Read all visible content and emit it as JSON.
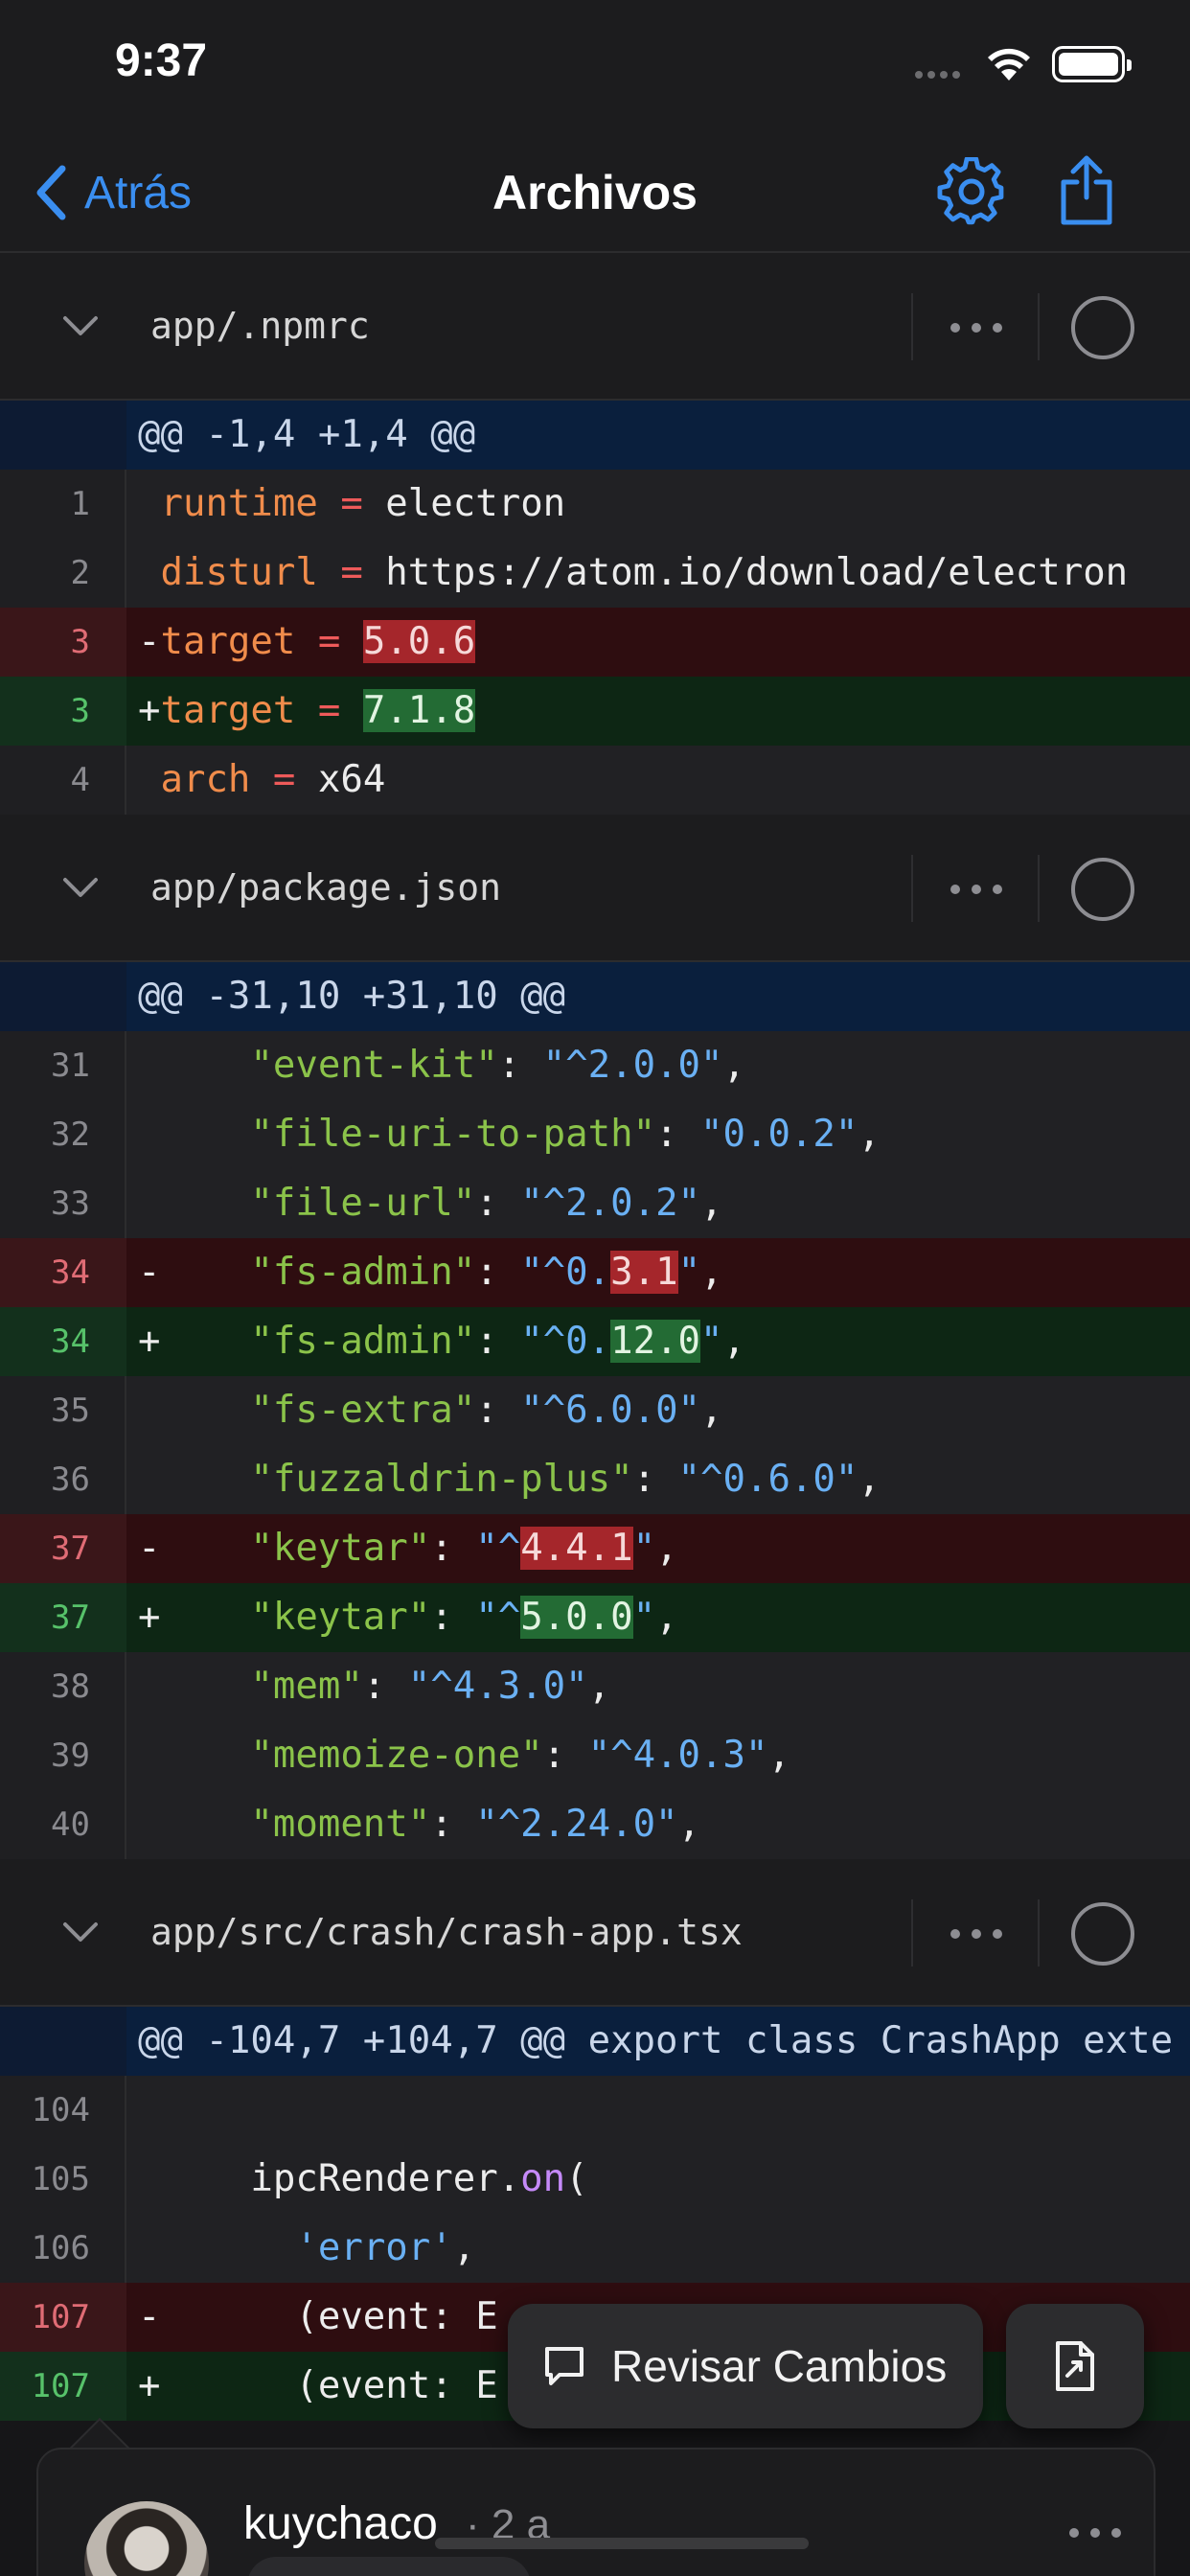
{
  "status_bar": {
    "time": "9:37"
  },
  "nav": {
    "back_label": "Atrás",
    "title": "Archivos"
  },
  "files": [
    {
      "path": "app/.npmrc",
      "lines": [
        {
          "type": "hunk",
          "num": "",
          "code": [
            {
              "t": "@@ -1,4 +1,4 @@"
            }
          ]
        },
        {
          "type": "ctx",
          "num": "1",
          "code": [
            {
              "t": " "
            },
            {
              "t": "runtime",
              "c": "k"
            },
            {
              "t": " "
            },
            {
              "t": "=",
              "c": "op"
            },
            {
              "t": " electron"
            }
          ]
        },
        {
          "type": "ctx",
          "num": "2",
          "code": [
            {
              "t": " "
            },
            {
              "t": "disturl",
              "c": "k"
            },
            {
              "t": " "
            },
            {
              "t": "=",
              "c": "op"
            },
            {
              "t": " https://atom.io/download/electron"
            }
          ]
        },
        {
          "type": "del",
          "num": "3",
          "code": [
            {
              "t": "-"
            },
            {
              "t": "target",
              "c": "k"
            },
            {
              "t": " "
            },
            {
              "t": "=",
              "c": "op"
            },
            {
              "t": " "
            },
            {
              "t": "5.0.6",
              "c": "hl-del"
            }
          ]
        },
        {
          "type": "add",
          "num": "3",
          "code": [
            {
              "t": "+"
            },
            {
              "t": "target",
              "c": "k"
            },
            {
              "t": " "
            },
            {
              "t": "=",
              "c": "op"
            },
            {
              "t": " "
            },
            {
              "t": "7.1.8",
              "c": "hl-add"
            }
          ]
        },
        {
          "type": "ctx",
          "num": "4",
          "code": [
            {
              "t": " "
            },
            {
              "t": "arch",
              "c": "k"
            },
            {
              "t": " "
            },
            {
              "t": "=",
              "c": "op"
            },
            {
              "t": " x64"
            }
          ]
        }
      ]
    },
    {
      "path": "app/package.json",
      "lines": [
        {
          "type": "hunk",
          "num": "",
          "code": [
            {
              "t": "@@ -31,10 +31,10 @@"
            }
          ]
        },
        {
          "type": "ctx",
          "num": "31",
          "code": [
            {
              "t": "     "
            },
            {
              "t": "\"event-kit\"",
              "c": "s"
            },
            {
              "t": ": "
            },
            {
              "t": "\"^2.0.0\"",
              "c": "n"
            },
            {
              "t": ","
            }
          ]
        },
        {
          "type": "ctx",
          "num": "32",
          "code": [
            {
              "t": "     "
            },
            {
              "t": "\"file-uri-to-path\"",
              "c": "s"
            },
            {
              "t": ": "
            },
            {
              "t": "\"0.0.2\"",
              "c": "n"
            },
            {
              "t": ","
            }
          ]
        },
        {
          "type": "ctx",
          "num": "33",
          "code": [
            {
              "t": "     "
            },
            {
              "t": "\"file-url\"",
              "c": "s"
            },
            {
              "t": ": "
            },
            {
              "t": "\"^2.0.2\"",
              "c": "n"
            },
            {
              "t": ","
            }
          ]
        },
        {
          "type": "del",
          "num": "34",
          "code": [
            {
              "t": "-    "
            },
            {
              "t": "\"fs-admin\"",
              "c": "s"
            },
            {
              "t": ": "
            },
            {
              "t": "\"^0.",
              "c": "n"
            },
            {
              "t": "3.1",
              "c": "hl-del"
            },
            {
              "t": "\"",
              "c": "n"
            },
            {
              "t": ","
            }
          ]
        },
        {
          "type": "add",
          "num": "34",
          "code": [
            {
              "t": "+    "
            },
            {
              "t": "\"fs-admin\"",
              "c": "s"
            },
            {
              "t": ": "
            },
            {
              "t": "\"^0.",
              "c": "n"
            },
            {
              "t": "12.0",
              "c": "hl-add"
            },
            {
              "t": "\"",
              "c": "n"
            },
            {
              "t": ","
            }
          ]
        },
        {
          "type": "ctx",
          "num": "35",
          "code": [
            {
              "t": "     "
            },
            {
              "t": "\"fs-extra\"",
              "c": "s"
            },
            {
              "t": ": "
            },
            {
              "t": "\"^6.0.0\"",
              "c": "n"
            },
            {
              "t": ","
            }
          ]
        },
        {
          "type": "ctx",
          "num": "36",
          "code": [
            {
              "t": "     "
            },
            {
              "t": "\"fuzzaldrin-plus\"",
              "c": "s"
            },
            {
              "t": ": "
            },
            {
              "t": "\"^0.6.0\"",
              "c": "n"
            },
            {
              "t": ","
            }
          ]
        },
        {
          "type": "del",
          "num": "37",
          "code": [
            {
              "t": "-    "
            },
            {
              "t": "\"keytar\"",
              "c": "s"
            },
            {
              "t": ": "
            },
            {
              "t": "\"^",
              "c": "n"
            },
            {
              "t": "4.4.1",
              "c": "hl-del"
            },
            {
              "t": "\"",
              "c": "n"
            },
            {
              "t": ","
            }
          ]
        },
        {
          "type": "add",
          "num": "37",
          "code": [
            {
              "t": "+    "
            },
            {
              "t": "\"keytar\"",
              "c": "s"
            },
            {
              "t": ": "
            },
            {
              "t": "\"^",
              "c": "n"
            },
            {
              "t": "5.0.0",
              "c": "hl-add"
            },
            {
              "t": "\"",
              "c": "n"
            },
            {
              "t": ","
            }
          ]
        },
        {
          "type": "ctx",
          "num": "38",
          "code": [
            {
              "t": "     "
            },
            {
              "t": "\"mem\"",
              "c": "s"
            },
            {
              "t": ": "
            },
            {
              "t": "\"^4.3.0\"",
              "c": "n"
            },
            {
              "t": ","
            }
          ]
        },
        {
          "type": "ctx",
          "num": "39",
          "code": [
            {
              "t": "     "
            },
            {
              "t": "\"memoize-one\"",
              "c": "s"
            },
            {
              "t": ": "
            },
            {
              "t": "\"^4.0.3\"",
              "c": "n"
            },
            {
              "t": ","
            }
          ]
        },
        {
          "type": "ctx",
          "num": "40",
          "code": [
            {
              "t": "     "
            },
            {
              "t": "\"moment\"",
              "c": "s"
            },
            {
              "t": ": "
            },
            {
              "t": "\"^2.24.0\"",
              "c": "n"
            },
            {
              "t": ","
            }
          ]
        }
      ]
    },
    {
      "path": "app/src/crash/crash-app.tsx",
      "lines": [
        {
          "type": "hunk",
          "num": "",
          "code": [
            {
              "t": "@@ -104,7 +104,7 @@ export class CrashApp exte"
            }
          ]
        },
        {
          "type": "ctx",
          "num": "104",
          "code": [
            {
              "t": ""
            }
          ]
        },
        {
          "type": "ctx",
          "num": "105",
          "code": [
            {
              "t": "     ipcRenderer."
            },
            {
              "t": "on",
              "c": "fn"
            },
            {
              "t": "("
            }
          ]
        },
        {
          "type": "ctx",
          "num": "106",
          "code": [
            {
              "t": "       "
            },
            {
              "t": "'error'",
              "c": "n"
            },
            {
              "t": ","
            }
          ]
        },
        {
          "type": "del",
          "num": "107",
          "code": [
            {
              "t": "-      (event: E"
            }
          ]
        },
        {
          "type": "add",
          "num": "107",
          "code": [
            {
              "t": "+      (event: E"
            }
          ]
        }
      ]
    }
  ],
  "actions": {
    "review_label": "Revisar Cambios"
  },
  "comment": {
    "author": "kuychaco",
    "ago": "· 2 a"
  },
  "colors": {
    "accent": "#3a8ef0",
    "deleted": "#a5262b",
    "added": "#236b34",
    "hunk": "#0a1f3d"
  }
}
